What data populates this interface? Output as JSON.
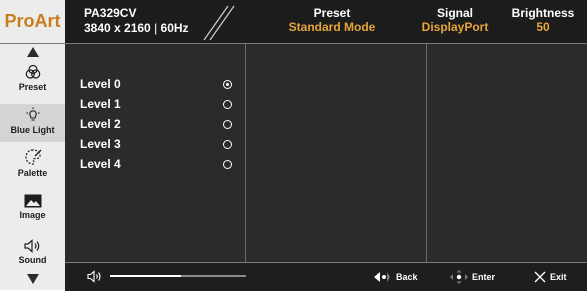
{
  "header": {
    "brand": "ProArt",
    "model": "PA329CV",
    "resolution": "3840 x 2160",
    "refresh": "60Hz",
    "preset_title": "Preset",
    "preset_value": "Standard Mode",
    "signal_title": "Signal",
    "signal_value": "DisplayPort",
    "brightness_title": "Brightness",
    "brightness_value": "50"
  },
  "sidebar": {
    "items": [
      {
        "label": "Preset",
        "icon": "preset-icon"
      },
      {
        "label": "Blue Light",
        "icon": "blue-light-icon"
      },
      {
        "label": "Palette",
        "icon": "palette-icon"
      },
      {
        "label": "Image",
        "icon": "image-icon"
      },
      {
        "label": "Sound",
        "icon": "sound-icon"
      }
    ],
    "active": "Blue Light"
  },
  "levels": {
    "options": [
      "Level 0",
      "Level 1",
      "Level 2",
      "Level 3",
      "Level 4"
    ],
    "selected": "Level 0"
  },
  "footer": {
    "volume_fraction": 0.52,
    "back_label": "Back",
    "enter_label": "Enter",
    "exit_label": "Exit"
  },
  "colors": {
    "accent": "#e7a53a",
    "brand": "#c97d1d",
    "panel": "#2b2b2b",
    "sidebar": "#ececec"
  }
}
